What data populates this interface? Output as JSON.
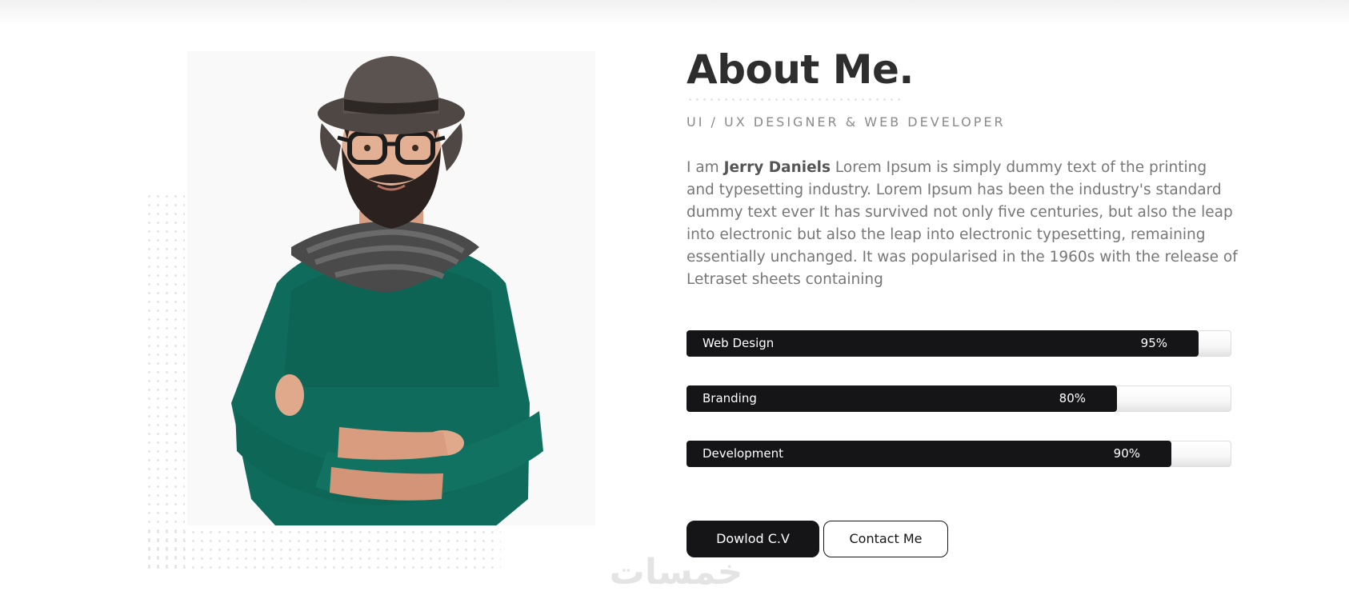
{
  "about": {
    "title": "About Me.",
    "subtitle": "UI / UX DESIGNER & WEB DEVELOPER",
    "bio_prefix": "I am ",
    "bio_name": "Jerry Daniels",
    "bio_text": " Lorem Ipsum is simply dummy text of the printing and typesetting industry. Lorem Ipsum has been the industry's standard dummy text ever It has survived not only five centuries, but also the leap into electronic but also the leap into electronic typesetting, remaining essentially unchanged. It was popularised in the 1960s with the release of Letraset sheets containing"
  },
  "skills": [
    {
      "name": "Web Design",
      "percent_label": "95%",
      "level": 0.95
    },
    {
      "name": "Branding",
      "percent_label": "80%",
      "level": 0.8
    },
    {
      "name": "Development",
      "percent_label": "90%",
      "level": 0.9
    }
  ],
  "buttons": {
    "download": "Dowlod C.V",
    "contact": "Contact Me"
  },
  "watermark": {
    "text": "خمسات"
  },
  "colors": {
    "accent": "#151517",
    "title": "#2e2e2e",
    "body_text": "#777777",
    "sweater": "#0f6b5b"
  }
}
